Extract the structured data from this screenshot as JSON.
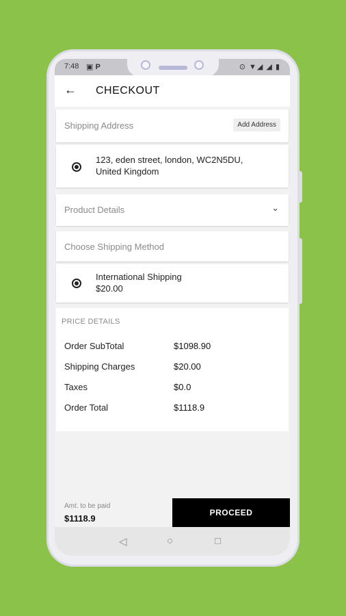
{
  "status_bar": {
    "time": "7:48",
    "left_icons": "▣ P",
    "right_icons": "⊙ ▼◢ ◢ ▮"
  },
  "header": {
    "back_icon": "arrow-left-icon",
    "title": "CHECKOUT"
  },
  "shipping_address": {
    "label": "Shipping Address",
    "add_button": "Add Address",
    "address_line1": "123, eden street, london, WC2N5DU,",
    "address_line2": "United Kingdom"
  },
  "product_details": {
    "label": "Product Details"
  },
  "shipping_method": {
    "label": "Choose Shipping Method",
    "option_name": "International Shipping",
    "option_price": "$20.00"
  },
  "price_details": {
    "heading": "PRICE DETAILS",
    "rows": [
      {
        "label": "Order SubTotal",
        "value": "$1098.90"
      },
      {
        "label": "Shipping Charges",
        "value": "$20.00"
      },
      {
        "label": "Taxes",
        "value": "$0.0"
      },
      {
        "label": "Order Total",
        "value": "$1118.9"
      }
    ]
  },
  "footer": {
    "amount_label": "Amt. to be paid",
    "amount_value": "$1118.9",
    "proceed_label": "PROCEED"
  },
  "nav": {
    "back": "◁",
    "home": "○",
    "recents": "□"
  },
  "colors": {
    "background": "#8bc34a",
    "button": "#000000"
  }
}
